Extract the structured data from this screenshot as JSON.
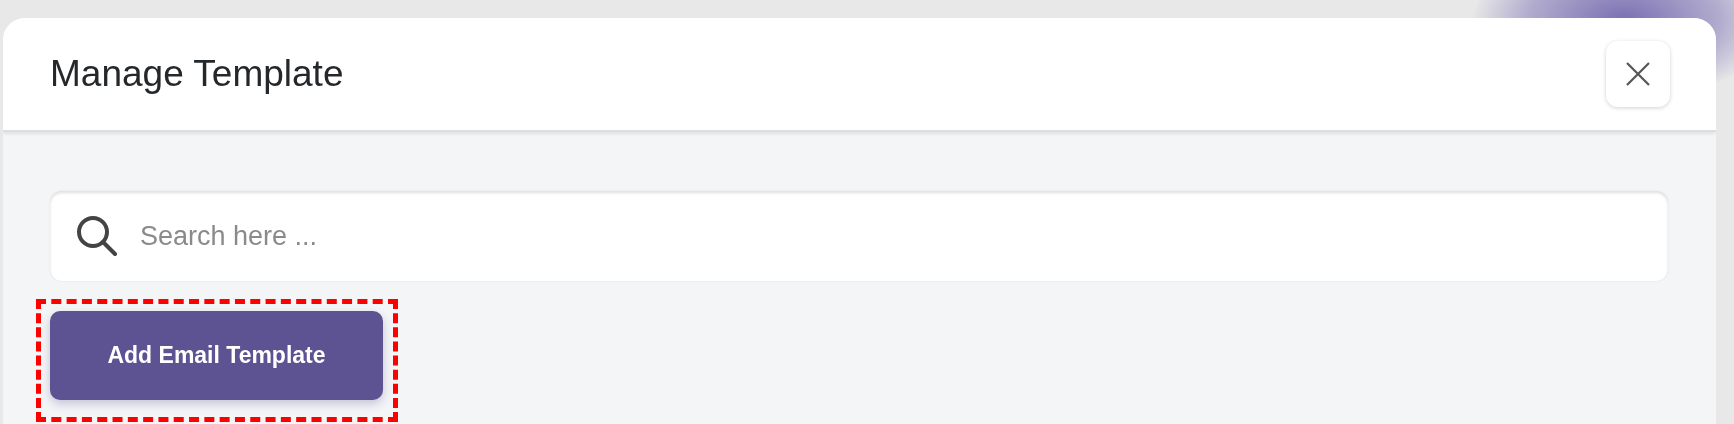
{
  "dialog": {
    "title": "Manage Template"
  },
  "search": {
    "placeholder": "Search here ..."
  },
  "buttons": [
    {
      "label": "Add Email Template",
      "highlighted": true
    }
  ]
}
